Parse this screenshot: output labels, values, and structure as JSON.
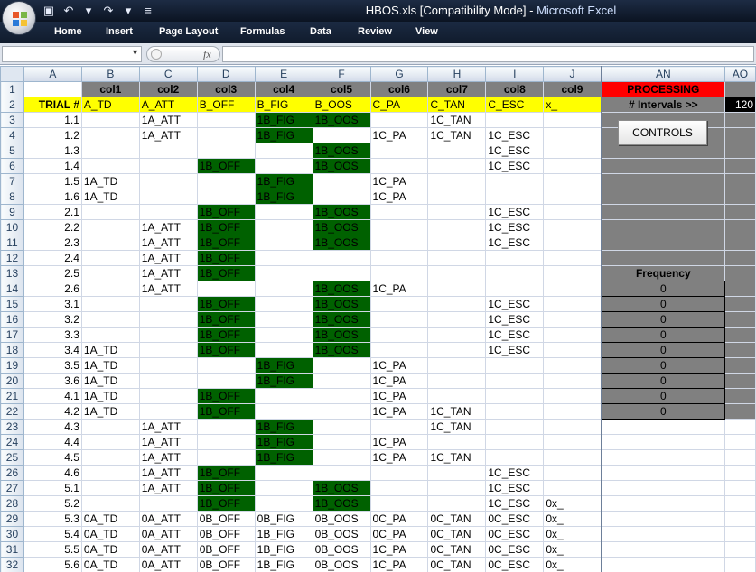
{
  "window": {
    "title": "HBOS.xls  [Compatibility Mode]",
    "app": "Microsoft Excel"
  },
  "ribbon": {
    "tabs": [
      "Home",
      "Insert",
      "Page Layout",
      "Formulas",
      "Data",
      "Review",
      "View"
    ]
  },
  "formula_bar": {
    "fx": "fx",
    "name_box": "",
    "formula": ""
  },
  "columns": [
    "A",
    "B",
    "C",
    "D",
    "E",
    "F",
    "G",
    "H",
    "I",
    "J",
    "AN",
    "AO"
  ],
  "row1": {
    "cols": [
      "",
      "col1",
      "col2",
      "col3",
      "col4",
      "col5",
      "col6",
      "col7",
      "col8",
      "col9"
    ],
    "AN": "PROCESSING"
  },
  "row2": {
    "cols": [
      "TRIAL #",
      "A_TD",
      "A_ATT",
      "B_OFF",
      "B_FIG",
      "B_OOS",
      "C_PA",
      "C_TAN",
      "C_ESC",
      "x_"
    ],
    "AN": "# Intervals  >>",
    "AO": "120"
  },
  "controls_button": "CONTROLS",
  "frequency_label": "Frequency",
  "frequency_values": [
    "0",
    "0",
    "0",
    "0",
    "0",
    "0",
    "0",
    "0",
    "0"
  ],
  "rows": [
    {
      "n": "3",
      "t": "1.1",
      "c": [
        "",
        "1A_ATT",
        "",
        "1B_FIG",
        "1B_OOS",
        "",
        "1C_TAN",
        "",
        ""
      ],
      "g": [
        4,
        5
      ]
    },
    {
      "n": "4",
      "t": "1.2",
      "c": [
        "",
        "1A_ATT",
        "",
        "1B_FIG",
        "",
        "1C_PA",
        "1C_TAN",
        "1C_ESC",
        ""
      ],
      "g": [
        4
      ]
    },
    {
      "n": "5",
      "t": "1.3",
      "c": [
        "",
        "",
        "",
        "",
        "1B_OOS",
        "",
        "",
        "1C_ESC",
        ""
      ],
      "g": [
        5
      ]
    },
    {
      "n": "6",
      "t": "1.4",
      "c": [
        "",
        "",
        "1B_OFF",
        "",
        "1B_OOS",
        "",
        "",
        "1C_ESC",
        ""
      ],
      "g": [
        3,
        5
      ]
    },
    {
      "n": "7",
      "t": "1.5",
      "c": [
        "1A_TD",
        "",
        "",
        "1B_FIG",
        "",
        "1C_PA",
        "",
        "",
        ""
      ],
      "g": [
        4
      ]
    },
    {
      "n": "8",
      "t": "1.6",
      "c": [
        "1A_TD",
        "",
        "",
        "1B_FIG",
        "",
        "1C_PA",
        "",
        "",
        ""
      ],
      "g": [
        4
      ]
    },
    {
      "n": "9",
      "t": "2.1",
      "c": [
        "",
        "",
        "1B_OFF",
        "",
        "1B_OOS",
        "",
        "",
        "1C_ESC",
        ""
      ],
      "g": [
        3,
        5
      ]
    },
    {
      "n": "10",
      "t": "2.2",
      "c": [
        "",
        "1A_ATT",
        "1B_OFF",
        "",
        "1B_OOS",
        "",
        "",
        "1C_ESC",
        ""
      ],
      "g": [
        3,
        5
      ]
    },
    {
      "n": "11",
      "t": "2.3",
      "c": [
        "",
        "1A_ATT",
        "1B_OFF",
        "",
        "1B_OOS",
        "",
        "",
        "1C_ESC",
        ""
      ],
      "g": [
        3,
        5
      ]
    },
    {
      "n": "12",
      "t": "2.4",
      "c": [
        "",
        "1A_ATT",
        "1B_OFF",
        "",
        "",
        "",
        "",
        "",
        ""
      ],
      "g": [
        3
      ]
    },
    {
      "n": "13",
      "t": "2.5",
      "c": [
        "",
        "1A_ATT",
        "1B_OFF",
        "",
        "",
        "",
        "",
        "",
        ""
      ],
      "g": [
        3
      ]
    },
    {
      "n": "14",
      "t": "2.6",
      "c": [
        "",
        "1A_ATT",
        "",
        "",
        "1B_OOS",
        "1C_PA",
        "",
        "",
        ""
      ],
      "g": [
        5
      ]
    },
    {
      "n": "15",
      "t": "3.1",
      "c": [
        "",
        "",
        "1B_OFF",
        "",
        "1B_OOS",
        "",
        "",
        "1C_ESC",
        ""
      ],
      "g": [
        3,
        5
      ]
    },
    {
      "n": "16",
      "t": "3.2",
      "c": [
        "",
        "",
        "1B_OFF",
        "",
        "1B_OOS",
        "",
        "",
        "1C_ESC",
        ""
      ],
      "g": [
        3,
        5
      ]
    },
    {
      "n": "17",
      "t": "3.3",
      "c": [
        "",
        "",
        "1B_OFF",
        "",
        "1B_OOS",
        "",
        "",
        "1C_ESC",
        ""
      ],
      "g": [
        3,
        5
      ]
    },
    {
      "n": "18",
      "t": "3.4",
      "c": [
        "1A_TD",
        "",
        "1B_OFF",
        "",
        "1B_OOS",
        "",
        "",
        "1C_ESC",
        ""
      ],
      "g": [
        3,
        5
      ]
    },
    {
      "n": "19",
      "t": "3.5",
      "c": [
        "1A_TD",
        "",
        "",
        "1B_FIG",
        "",
        "1C_PA",
        "",
        "",
        ""
      ],
      "g": [
        4
      ]
    },
    {
      "n": "20",
      "t": "3.6",
      "c": [
        "1A_TD",
        "",
        "",
        "1B_FIG",
        "",
        "1C_PA",
        "",
        "",
        ""
      ],
      "g": [
        4
      ]
    },
    {
      "n": "21",
      "t": "4.1",
      "c": [
        "1A_TD",
        "",
        "1B_OFF",
        "",
        "",
        "1C_PA",
        "",
        "",
        ""
      ],
      "g": [
        3
      ]
    },
    {
      "n": "22",
      "t": "4.2",
      "c": [
        "1A_TD",
        "",
        "1B_OFF",
        "",
        "",
        "1C_PA",
        "1C_TAN",
        "",
        ""
      ],
      "g": [
        3
      ]
    },
    {
      "n": "23",
      "t": "4.3",
      "c": [
        "",
        "1A_ATT",
        "",
        "1B_FIG",
        "",
        "",
        "1C_TAN",
        "",
        ""
      ],
      "g": [
        4
      ]
    },
    {
      "n": "24",
      "t": "4.4",
      "c": [
        "",
        "1A_ATT",
        "",
        "1B_FIG",
        "",
        "1C_PA",
        "",
        "",
        ""
      ],
      "g": [
        4
      ]
    },
    {
      "n": "25",
      "t": "4.5",
      "c": [
        "",
        "1A_ATT",
        "",
        "1B_FIG",
        "",
        "1C_PA",
        "1C_TAN",
        "",
        ""
      ],
      "g": [
        4
      ]
    },
    {
      "n": "26",
      "t": "4.6",
      "c": [
        "",
        "1A_ATT",
        "1B_OFF",
        "",
        "",
        "",
        "",
        "1C_ESC",
        ""
      ],
      "g": [
        3
      ]
    },
    {
      "n": "27",
      "t": "5.1",
      "c": [
        "",
        "1A_ATT",
        "1B_OFF",
        "",
        "1B_OOS",
        "",
        "",
        "1C_ESC",
        ""
      ],
      "g": [
        3,
        5
      ]
    },
    {
      "n": "28",
      "t": "5.2",
      "c": [
        "",
        "",
        "1B_OFF",
        "",
        "1B_OOS",
        "",
        "",
        "1C_ESC",
        "0x_"
      ],
      "g": [
        3,
        5
      ]
    },
    {
      "n": "29",
      "t": "5.3",
      "c": [
        "0A_TD",
        "0A_ATT",
        "0B_OFF",
        "0B_FIG",
        "0B_OOS",
        "0C_PA",
        "0C_TAN",
        "0C_ESC",
        "0x_"
      ],
      "g": []
    },
    {
      "n": "30",
      "t": "5.4",
      "c": [
        "0A_TD",
        "0A_ATT",
        "0B_OFF",
        "1B_FIG",
        "0B_OOS",
        "0C_PA",
        "0C_TAN",
        "0C_ESC",
        "0x_"
      ],
      "g": []
    },
    {
      "n": "31",
      "t": "5.5",
      "c": [
        "0A_TD",
        "0A_ATT",
        "0B_OFF",
        "1B_FIG",
        "0B_OOS",
        "1C_PA",
        "0C_TAN",
        "0C_ESC",
        "0x_"
      ],
      "g": []
    },
    {
      "n": "32",
      "t": "5.6",
      "c": [
        "0A_TD",
        "0A_ATT",
        "0B_OFF",
        "1B_FIG",
        "0B_OOS",
        "1C_PA",
        "0C_TAN",
        "0C_ESC",
        "0x_"
      ],
      "g": []
    }
  ]
}
